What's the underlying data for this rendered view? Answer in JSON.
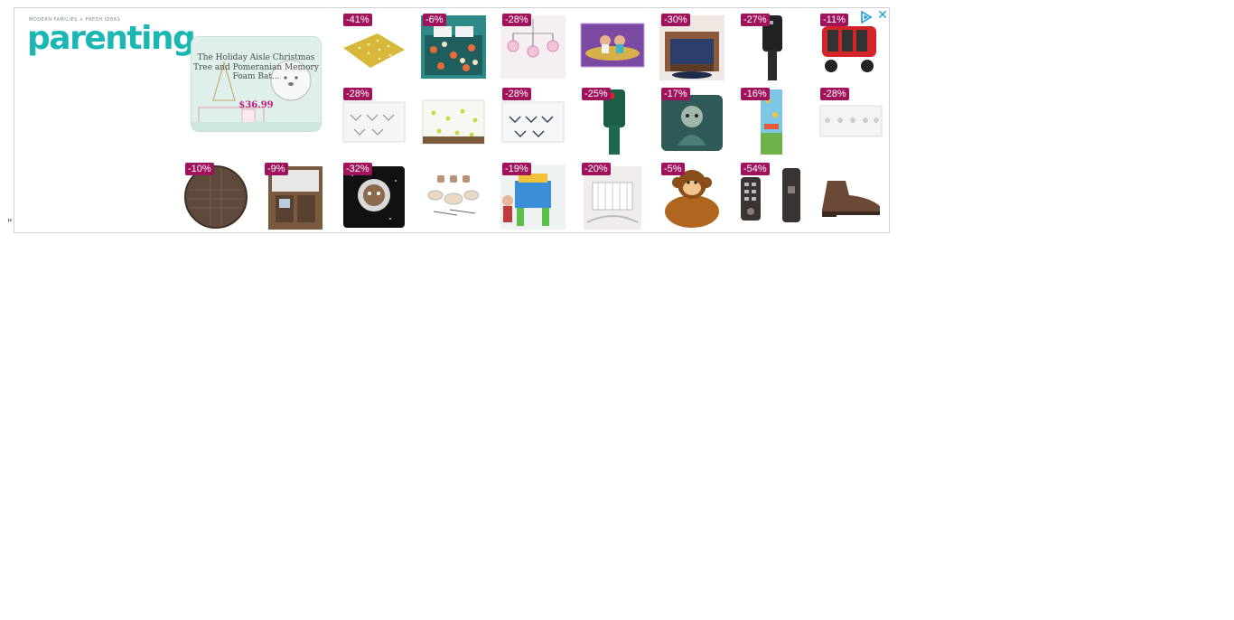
{
  "stray_text": "\"",
  "ad": {
    "logo": {
      "tagline": "MODERN FAMILIES + FRESH IDEAS",
      "wordmark": "parenting"
    },
    "adchoices_icon": "adchoices-triangle-icon",
    "close_icon": "✕",
    "featured": {
      "title": "The Holiday Aisle Christmas Tree and Pomeranian Memory Foam Bat...",
      "price": "$36.99"
    },
    "badge_color": "#a0125c",
    "accent_color": "#1bb7b3",
    "products": [
      {
        "discount": "-41%",
        "icon": "yellow-dot-fabric"
      },
      {
        "discount": "-6%",
        "icon": "floral-bedding-set"
      },
      {
        "discount": "-28%",
        "icon": "pink-crib-mobile"
      },
      {
        "discount": "",
        "icon": "aladdin-jasmine-rug"
      },
      {
        "discount": "-30%",
        "icon": "wooden-toddler-bed"
      },
      {
        "discount": "-27%",
        "icon": "black-mailbox-post"
      },
      {
        "discount": "-11%",
        "icon": "red-multi-seat-stroller"
      },
      {
        "discount": "-28%",
        "icon": "arrow-crib-skirt"
      },
      {
        "discount": "",
        "icon": "polka-dot-crib-skirt"
      },
      {
        "discount": "-28%",
        "icon": "navy-arrow-crib-skirt"
      },
      {
        "discount": "-25%",
        "icon": "green-mailbox-post"
      },
      {
        "discount": "-17%",
        "icon": "mermaid-throw-pillow"
      },
      {
        "discount": "-16%",
        "icon": "growth-chart"
      },
      {
        "discount": "-28%",
        "icon": "lace-crib-skirt"
      },
      {
        "discount": "-10%",
        "icon": "round-woven-rug"
      },
      {
        "discount": "-9%",
        "icon": "play-kitchen"
      },
      {
        "discount": "-32%",
        "icon": "space-cat-pillow"
      },
      {
        "discount": "",
        "icon": "toy-tea-set"
      },
      {
        "discount": "-19%",
        "icon": "kids-activity-table"
      },
      {
        "discount": "-20%",
        "icon": "white-cradle"
      },
      {
        "discount": "-5%",
        "icon": "monkey-kids-chair"
      },
      {
        "discount": "-54%",
        "icon": "smart-door-lock"
      },
      {
        "discount": "",
        "icon": "brown-ankle-boot"
      }
    ]
  }
}
